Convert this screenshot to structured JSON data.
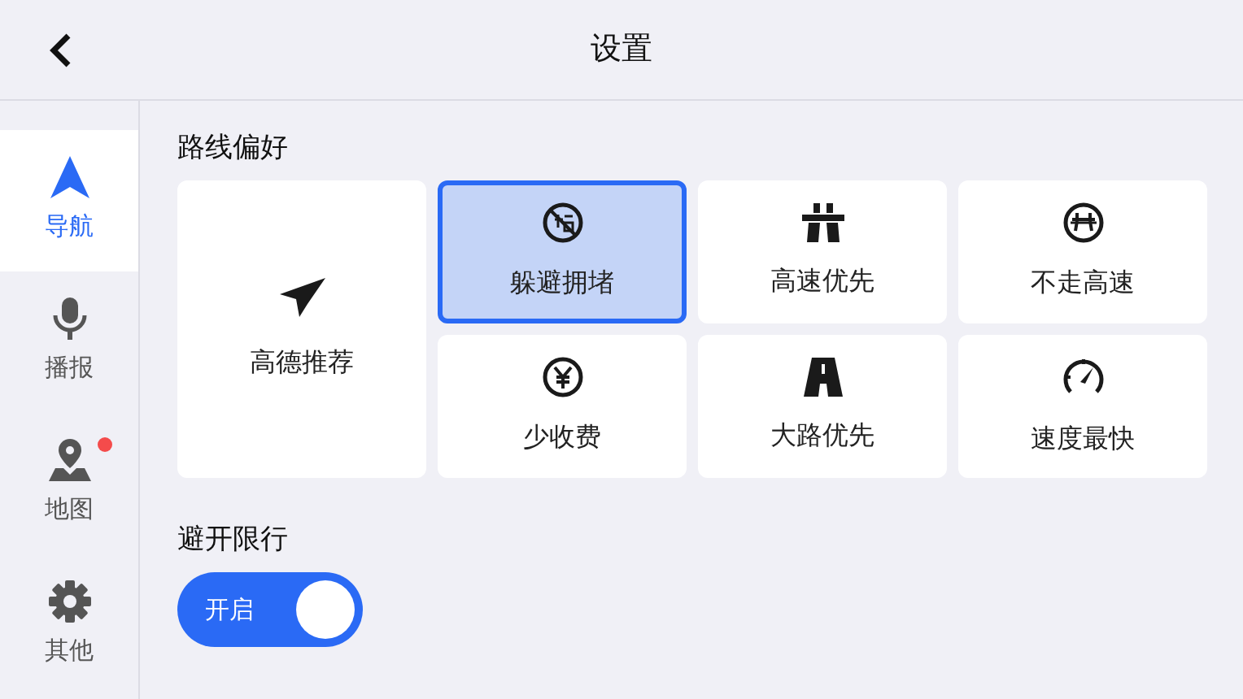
{
  "header": {
    "title": "设置"
  },
  "sidebar": {
    "items": [
      {
        "label": "导航",
        "kind": "navigation",
        "selected": true,
        "badge": false
      },
      {
        "label": "播报",
        "kind": "microphone",
        "selected": false,
        "badge": false
      },
      {
        "label": "地图",
        "kind": "map",
        "selected": false,
        "badge": true
      },
      {
        "label": "其他",
        "kind": "gear",
        "selected": false,
        "badge": false
      }
    ]
  },
  "route_preference": {
    "title": "路线偏好",
    "options": [
      {
        "label": "高德推荐",
        "kind": "recommended",
        "selected": false
      },
      {
        "label": "躲避拥堵",
        "kind": "avoid-jam",
        "selected": true
      },
      {
        "label": "高速优先",
        "kind": "highway",
        "selected": false
      },
      {
        "label": "不走高速",
        "kind": "no-highway",
        "selected": false
      },
      {
        "label": "少收费",
        "kind": "toll",
        "selected": false
      },
      {
        "label": "大路优先",
        "kind": "main-road",
        "selected": false
      },
      {
        "label": "速度最快",
        "kind": "fastest",
        "selected": false
      }
    ]
  },
  "restriction": {
    "title": "避开限行",
    "toggle": {
      "label": "开启",
      "on": true
    }
  }
}
